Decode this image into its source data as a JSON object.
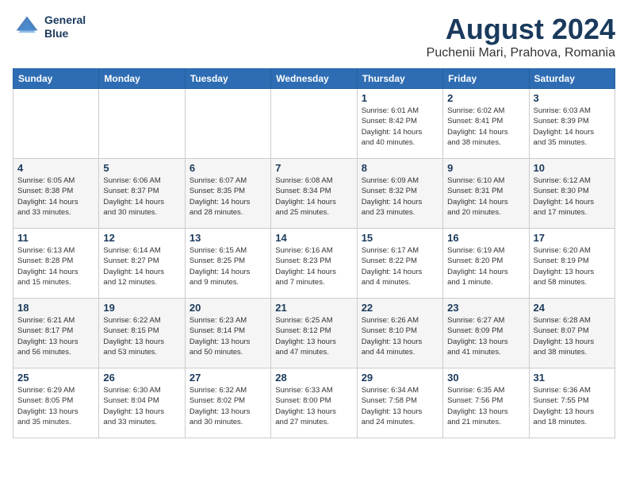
{
  "header": {
    "logo_line1": "General",
    "logo_line2": "Blue",
    "month": "August 2024",
    "location": "Puchenii Mari, Prahova, Romania"
  },
  "weekdays": [
    "Sunday",
    "Monday",
    "Tuesday",
    "Wednesday",
    "Thursday",
    "Friday",
    "Saturday"
  ],
  "weeks": [
    [
      {
        "day": "",
        "info": ""
      },
      {
        "day": "",
        "info": ""
      },
      {
        "day": "",
        "info": ""
      },
      {
        "day": "",
        "info": ""
      },
      {
        "day": "1",
        "info": "Sunrise: 6:01 AM\nSunset: 8:42 PM\nDaylight: 14 hours\nand 40 minutes."
      },
      {
        "day": "2",
        "info": "Sunrise: 6:02 AM\nSunset: 8:41 PM\nDaylight: 14 hours\nand 38 minutes."
      },
      {
        "day": "3",
        "info": "Sunrise: 6:03 AM\nSunset: 8:39 PM\nDaylight: 14 hours\nand 35 minutes."
      }
    ],
    [
      {
        "day": "4",
        "info": "Sunrise: 6:05 AM\nSunset: 8:38 PM\nDaylight: 14 hours\nand 33 minutes."
      },
      {
        "day": "5",
        "info": "Sunrise: 6:06 AM\nSunset: 8:37 PM\nDaylight: 14 hours\nand 30 minutes."
      },
      {
        "day": "6",
        "info": "Sunrise: 6:07 AM\nSunset: 8:35 PM\nDaylight: 14 hours\nand 28 minutes."
      },
      {
        "day": "7",
        "info": "Sunrise: 6:08 AM\nSunset: 8:34 PM\nDaylight: 14 hours\nand 25 minutes."
      },
      {
        "day": "8",
        "info": "Sunrise: 6:09 AM\nSunset: 8:32 PM\nDaylight: 14 hours\nand 23 minutes."
      },
      {
        "day": "9",
        "info": "Sunrise: 6:10 AM\nSunset: 8:31 PM\nDaylight: 14 hours\nand 20 minutes."
      },
      {
        "day": "10",
        "info": "Sunrise: 6:12 AM\nSunset: 8:30 PM\nDaylight: 14 hours\nand 17 minutes."
      }
    ],
    [
      {
        "day": "11",
        "info": "Sunrise: 6:13 AM\nSunset: 8:28 PM\nDaylight: 14 hours\nand 15 minutes."
      },
      {
        "day": "12",
        "info": "Sunrise: 6:14 AM\nSunset: 8:27 PM\nDaylight: 14 hours\nand 12 minutes."
      },
      {
        "day": "13",
        "info": "Sunrise: 6:15 AM\nSunset: 8:25 PM\nDaylight: 14 hours\nand 9 minutes."
      },
      {
        "day": "14",
        "info": "Sunrise: 6:16 AM\nSunset: 8:23 PM\nDaylight: 14 hours\nand 7 minutes."
      },
      {
        "day": "15",
        "info": "Sunrise: 6:17 AM\nSunset: 8:22 PM\nDaylight: 14 hours\nand 4 minutes."
      },
      {
        "day": "16",
        "info": "Sunrise: 6:19 AM\nSunset: 8:20 PM\nDaylight: 14 hours\nand 1 minute."
      },
      {
        "day": "17",
        "info": "Sunrise: 6:20 AM\nSunset: 8:19 PM\nDaylight: 13 hours\nand 58 minutes."
      }
    ],
    [
      {
        "day": "18",
        "info": "Sunrise: 6:21 AM\nSunset: 8:17 PM\nDaylight: 13 hours\nand 56 minutes."
      },
      {
        "day": "19",
        "info": "Sunrise: 6:22 AM\nSunset: 8:15 PM\nDaylight: 13 hours\nand 53 minutes."
      },
      {
        "day": "20",
        "info": "Sunrise: 6:23 AM\nSunset: 8:14 PM\nDaylight: 13 hours\nand 50 minutes."
      },
      {
        "day": "21",
        "info": "Sunrise: 6:25 AM\nSunset: 8:12 PM\nDaylight: 13 hours\nand 47 minutes."
      },
      {
        "day": "22",
        "info": "Sunrise: 6:26 AM\nSunset: 8:10 PM\nDaylight: 13 hours\nand 44 minutes."
      },
      {
        "day": "23",
        "info": "Sunrise: 6:27 AM\nSunset: 8:09 PM\nDaylight: 13 hours\nand 41 minutes."
      },
      {
        "day": "24",
        "info": "Sunrise: 6:28 AM\nSunset: 8:07 PM\nDaylight: 13 hours\nand 38 minutes."
      }
    ],
    [
      {
        "day": "25",
        "info": "Sunrise: 6:29 AM\nSunset: 8:05 PM\nDaylight: 13 hours\nand 35 minutes."
      },
      {
        "day": "26",
        "info": "Sunrise: 6:30 AM\nSunset: 8:04 PM\nDaylight: 13 hours\nand 33 minutes."
      },
      {
        "day": "27",
        "info": "Sunrise: 6:32 AM\nSunset: 8:02 PM\nDaylight: 13 hours\nand 30 minutes."
      },
      {
        "day": "28",
        "info": "Sunrise: 6:33 AM\nSunset: 8:00 PM\nDaylight: 13 hours\nand 27 minutes."
      },
      {
        "day": "29",
        "info": "Sunrise: 6:34 AM\nSunset: 7:58 PM\nDaylight: 13 hours\nand 24 minutes."
      },
      {
        "day": "30",
        "info": "Sunrise: 6:35 AM\nSunset: 7:56 PM\nDaylight: 13 hours\nand 21 minutes."
      },
      {
        "day": "31",
        "info": "Sunrise: 6:36 AM\nSunset: 7:55 PM\nDaylight: 13 hours\nand 18 minutes."
      }
    ]
  ]
}
